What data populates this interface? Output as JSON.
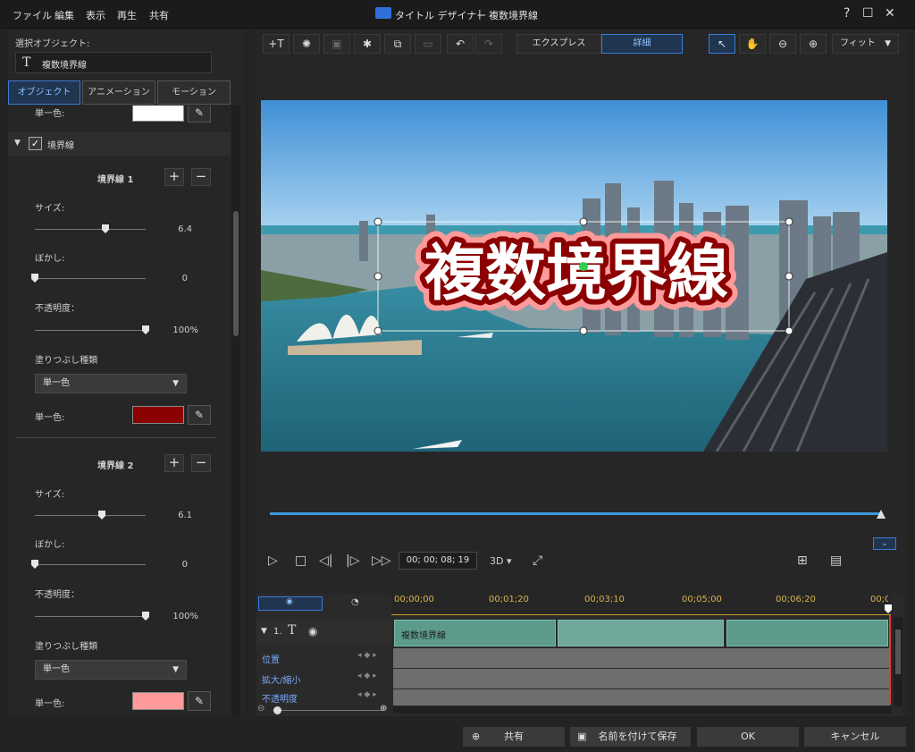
{
  "menu": [
    "ファイル",
    "編集",
    "表示",
    "再生",
    "共有"
  ],
  "window": {
    "title": "タイトル デザイナー",
    "separator": "|",
    "doc": "複数境界線"
  },
  "winbuttons": {
    "help": "?",
    "max": "☐",
    "close": "✕"
  },
  "left": {
    "selected_label": "選択オブジェクト:",
    "selected_value": "複数境界線",
    "tabs": [
      "オブジェクト",
      "アニメーション",
      "モーション"
    ],
    "top_fill": {
      "label": "単一色:",
      "color": "#ffffff"
    },
    "border_header": "境界線",
    "border1": {
      "title": "境界線 1",
      "size_label": "サイズ:",
      "size_val": "6.4",
      "size_frac": 0.64,
      "blur_label": "ぼかし:",
      "blur_val": "0",
      "blur_frac": 0.0,
      "opacity_label": "不透明度：",
      "opacity_val": "100%",
      "opacity_frac": 1.0,
      "fill_type_label": "塗りつぶし種類",
      "fill_type_value": "単一色",
      "color_label": "単一色:",
      "color": "#8b0000"
    },
    "border2": {
      "title": "境界線 2",
      "size_label": "サイズ:",
      "size_val": "6.1",
      "size_frac": 0.61,
      "blur_label": "ぼかし:",
      "blur_val": "0",
      "blur_frac": 0.0,
      "opacity_label": "不透明度：",
      "opacity_val": "100%",
      "opacity_frac": 1.0,
      "fill_type_label": "塗りつぶし種類",
      "fill_type_value": "単一色",
      "color_label": "単一色:",
      "color": "#ff9a9a"
    }
  },
  "toolbar": {
    "express": "エクスプレス",
    "detail": "詳細",
    "fit": "フィット"
  },
  "preview": {
    "title_text": "複数境界線",
    "text_color": "#ffffff",
    "border1_color": "#8b0000",
    "border2_color": "#ff9a9a",
    "progress": 0.98
  },
  "playback": {
    "timecode": "00; 00; 08; 19",
    "mode": "3D"
  },
  "timeline": {
    "ruler": [
      "00;00;00",
      "00;01;20",
      "00;03;10",
      "00;05;00",
      "00;06;20",
      "00;0"
    ],
    "track": {
      "index": "1.",
      "clip": "複数境界線"
    },
    "props": [
      "位置",
      "拡大/縮小",
      "不透明度"
    ]
  },
  "footer": {
    "share": "共有",
    "save_as": "名前を付けて保存",
    "ok": "OK",
    "cancel": "キャンセル"
  }
}
